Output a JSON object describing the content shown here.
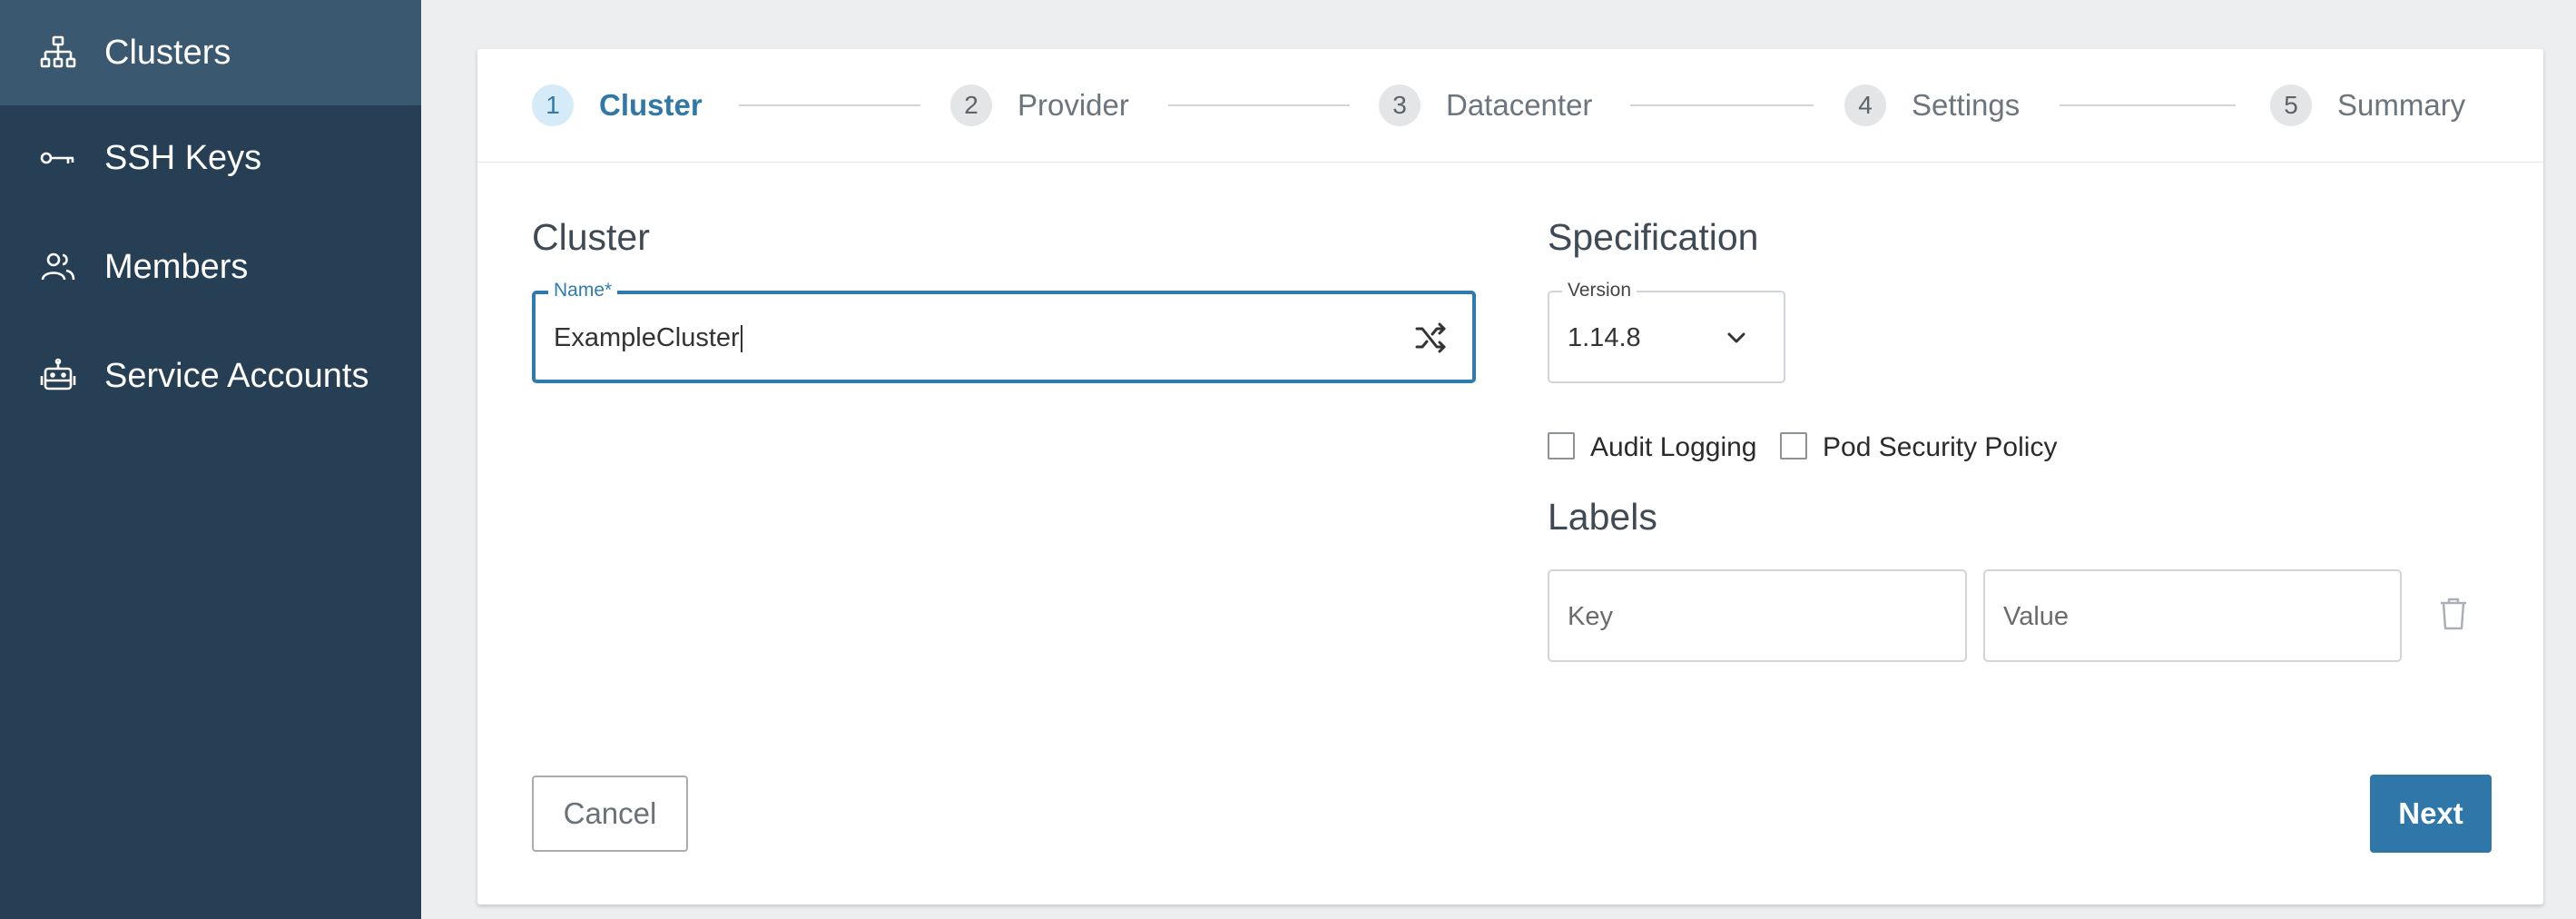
{
  "sidebar": {
    "items": [
      {
        "label": "Clusters",
        "icon": "sitemap-icon",
        "active": true
      },
      {
        "label": "SSH Keys",
        "icon": "key-icon",
        "active": false
      },
      {
        "label": "Members",
        "icon": "users-icon",
        "active": false
      },
      {
        "label": "Service Accounts",
        "icon": "robot-icon",
        "active": false
      }
    ]
  },
  "stepper": {
    "steps": [
      {
        "num": "1",
        "label": "Cluster",
        "active": true
      },
      {
        "num": "2",
        "label": "Provider",
        "active": false
      },
      {
        "num": "3",
        "label": "Datacenter",
        "active": false
      },
      {
        "num": "4",
        "label": "Settings",
        "active": false
      },
      {
        "num": "5",
        "label": "Summary",
        "active": false
      }
    ]
  },
  "cluster": {
    "title": "Cluster",
    "name_legend": "Name*",
    "name_value": "ExampleCluster",
    "shuffle_icon": "shuffle-icon"
  },
  "spec": {
    "title": "Specification",
    "version_legend": "Version",
    "version_value": "1.14.8",
    "audit_logging": "Audit Logging",
    "pod_security_policy": "Pod Security Policy"
  },
  "labels": {
    "title": "Labels",
    "key_placeholder": "Key",
    "value_placeholder": "Value",
    "delete_icon": "trash-icon"
  },
  "actions": {
    "cancel": "Cancel",
    "next": "Next"
  },
  "colors": {
    "sidebar": "#263f55",
    "sidebar_active": "#3a5870",
    "accent": "#2f77a9"
  }
}
